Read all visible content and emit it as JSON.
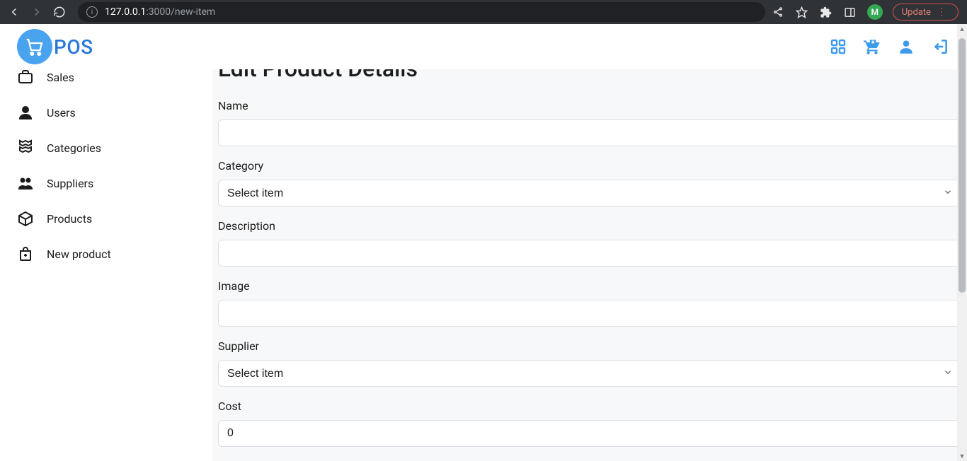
{
  "browser": {
    "url_host": "127.0.0.1",
    "url_port_path": ":3000/new-item",
    "avatar_letter": "M",
    "update_label": "Update"
  },
  "header": {
    "brand": "POS"
  },
  "sidebar": {
    "items": [
      {
        "label": "Sales"
      },
      {
        "label": "Users"
      },
      {
        "label": "Categories"
      },
      {
        "label": "Suppliers"
      },
      {
        "label": "Products"
      },
      {
        "label": "New product"
      }
    ]
  },
  "main": {
    "title": "Edit Product Details",
    "form": {
      "name": {
        "label": "Name",
        "value": ""
      },
      "category": {
        "label": "Category",
        "placeholder": "Select item"
      },
      "description": {
        "label": "Description",
        "value": ""
      },
      "image": {
        "label": "Image",
        "value": ""
      },
      "supplier": {
        "label": "Supplier",
        "placeholder": "Select item"
      },
      "cost": {
        "label": "Cost",
        "value": "0"
      }
    }
  }
}
